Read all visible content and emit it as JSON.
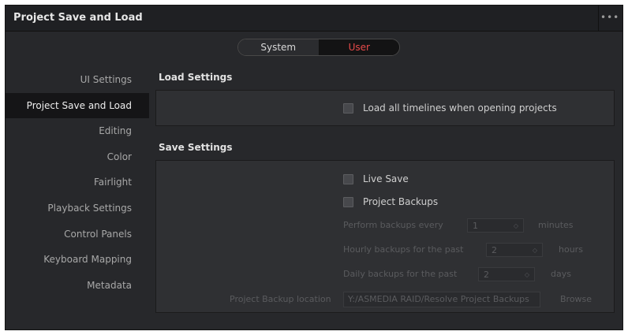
{
  "window": {
    "title": "Project Save and Load",
    "more_glyph": "•••"
  },
  "tabs": [
    {
      "label": "System",
      "active": false
    },
    {
      "label": "User",
      "active": true,
      "color": "#e84a4a"
    }
  ],
  "sidebar": {
    "items": [
      {
        "label": "UI Settings",
        "active": false
      },
      {
        "label": "Project Save and Load",
        "active": true
      },
      {
        "label": "Editing",
        "active": false
      },
      {
        "label": "Color",
        "active": false
      },
      {
        "label": "Fairlight",
        "active": false
      },
      {
        "label": "Playback Settings",
        "active": false
      },
      {
        "label": "Control Panels",
        "active": false
      },
      {
        "label": "Keyboard Mapping",
        "active": false
      },
      {
        "label": "Metadata",
        "active": false
      }
    ]
  },
  "load_settings": {
    "title": "Load Settings",
    "load_all_timelines": {
      "label": "Load all timelines when opening projects",
      "checked": false
    }
  },
  "save_settings": {
    "title": "Save Settings",
    "live_save": {
      "label": "Live Save",
      "checked": false
    },
    "project_backups": {
      "label": "Project Backups",
      "checked": false
    },
    "perform_backups": {
      "label": "Perform backups every",
      "value": "1",
      "unit": "minutes"
    },
    "hourly_backups": {
      "label": "Hourly backups for the past",
      "value": "2",
      "unit": "hours"
    },
    "daily_backups": {
      "label": "Daily backups for the past",
      "value": "2",
      "unit": "days"
    },
    "backup_location": {
      "label": "Project Backup location",
      "value": "Y:/ASMEDIA RAID/Resolve Project Backups",
      "browse_label": "Browse"
    }
  }
}
